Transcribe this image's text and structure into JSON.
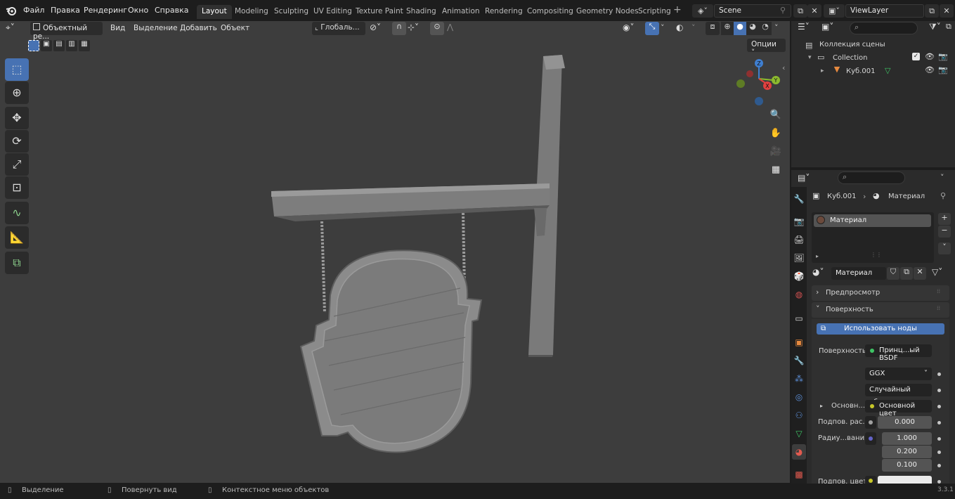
{
  "app_logo": "blender-logo-icon",
  "menu": [
    "Файл",
    "Правка",
    "Рендеринг",
    "Окно",
    "Справка"
  ],
  "workspaces": [
    {
      "label": "Layout",
      "active": true
    },
    {
      "label": "Modeling",
      "active": false
    },
    {
      "label": "Sculpting",
      "active": false
    },
    {
      "label": "UV Editing",
      "active": false
    },
    {
      "label": "Texture Paint",
      "active": false
    },
    {
      "label": "Shading",
      "active": false
    },
    {
      "label": "Animation",
      "active": false
    },
    {
      "label": "Rendering",
      "active": false
    },
    {
      "label": "Compositing",
      "active": false
    },
    {
      "label": "Geometry Nodes",
      "active": false
    },
    {
      "label": "Scripting",
      "active": false
    }
  ],
  "add_workspace": "+",
  "scene": "Scene",
  "view_layer": "ViewLayer",
  "viewport_header": {
    "mode": "Объектный ре...",
    "menus": [
      "Вид",
      "Выделение",
      "Добавить",
      "Объект"
    ],
    "transform_orientation": "Глобаль...",
    "options": "Опции"
  },
  "gizmo": {
    "z": "Z",
    "y": "Y",
    "x": "X"
  },
  "outliner": {
    "scene_collection": "Коллекция сцены",
    "collection": "Collection",
    "object": "Куб.001"
  },
  "properties": {
    "breadcrumb_object": "Куб.001",
    "breadcrumb_material": "Материал",
    "slot": "Материал",
    "material_name": "Материал",
    "panel_preview": "Предпросмотр",
    "panel_surface": "Поверхность",
    "use_nodes": "Использовать ноды",
    "surface_label": "Поверхность",
    "surface_value": "Принц...ый BSDF",
    "distribution": "GGX",
    "subsurface_method": "Случайный обх...",
    "base_color_label": "Основн...",
    "base_color_value": "Основной цвет",
    "subsurface_label": "Подпов. рас...",
    "subsurface_value": "0.000",
    "radius_label": "Радиу...вания",
    "radius": [
      "1.000",
      "0.200",
      "0.100"
    ],
    "subsurface_color_label": "Подпов. цвет"
  },
  "status": {
    "select": "Выделение",
    "rotate": "Повернуть вид",
    "context": "Контекстное меню объектов",
    "version": "3.3.1"
  },
  "colors": {
    "accent": "#4772b3",
    "x_axis": "#e2403f",
    "y_axis": "#8cba2e",
    "z_axis": "#3f7fd1",
    "socket_yellow": "#c7c729",
    "socket_green": "#3ec465",
    "socket_purple": "#6363c7"
  }
}
